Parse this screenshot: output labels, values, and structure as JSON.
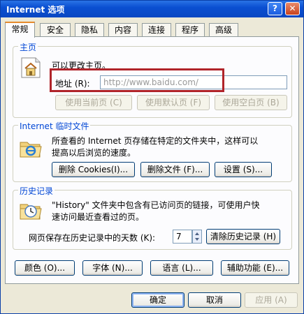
{
  "window": {
    "title": "Internet 选项",
    "help_glyph": "?",
    "close_glyph": "✕"
  },
  "tabs": [
    "常规",
    "安全",
    "隐私",
    "内容",
    "连接",
    "程序",
    "高级"
  ],
  "homepage": {
    "legend": "主页",
    "description": "可以更改主页。",
    "address_label": "地址 (R):",
    "address_value": "http://www.baidu.com/",
    "btn_use_current": "使用当前页 (C)",
    "btn_use_default": "使用默认页 (F)",
    "btn_use_blank": "使用空白页 (B)"
  },
  "temp_files": {
    "legend": "Internet 临时文件",
    "description_line1": "所查看的 Internet 页存储在特定的文件夹中，这样可以",
    "description_line2": "提高以后浏览的速度。",
    "btn_delete_cookies": "删除 Cookies(I)...",
    "btn_delete_files": "删除文件 (F)...",
    "btn_settings": "设置 (S)..."
  },
  "history": {
    "legend": "历史记录",
    "description_line1": "\"History\" 文件夹中包含有已访问页的链接，可使用户快",
    "description_line2": "速访问最近查看过的页。",
    "days_label": "网页保存在历史记录中的天数 (K):",
    "days_value": "7",
    "btn_clear_history": "清除历史记录 (H)"
  },
  "bottom_buttons": {
    "colors": "颜色 (O)...",
    "fonts": "字体 (N)...",
    "languages": "语言 (L)...",
    "accessibility": "辅助功能 (E)..."
  },
  "dialog_buttons": {
    "ok": "确定",
    "cancel": "取消",
    "apply": "应用 (A)"
  },
  "colors": {
    "titlebar": "#0a4fd1",
    "group_label": "#0046d5",
    "highlight_box": "#b0242a",
    "tab_active_accent": "#e68b2c"
  }
}
